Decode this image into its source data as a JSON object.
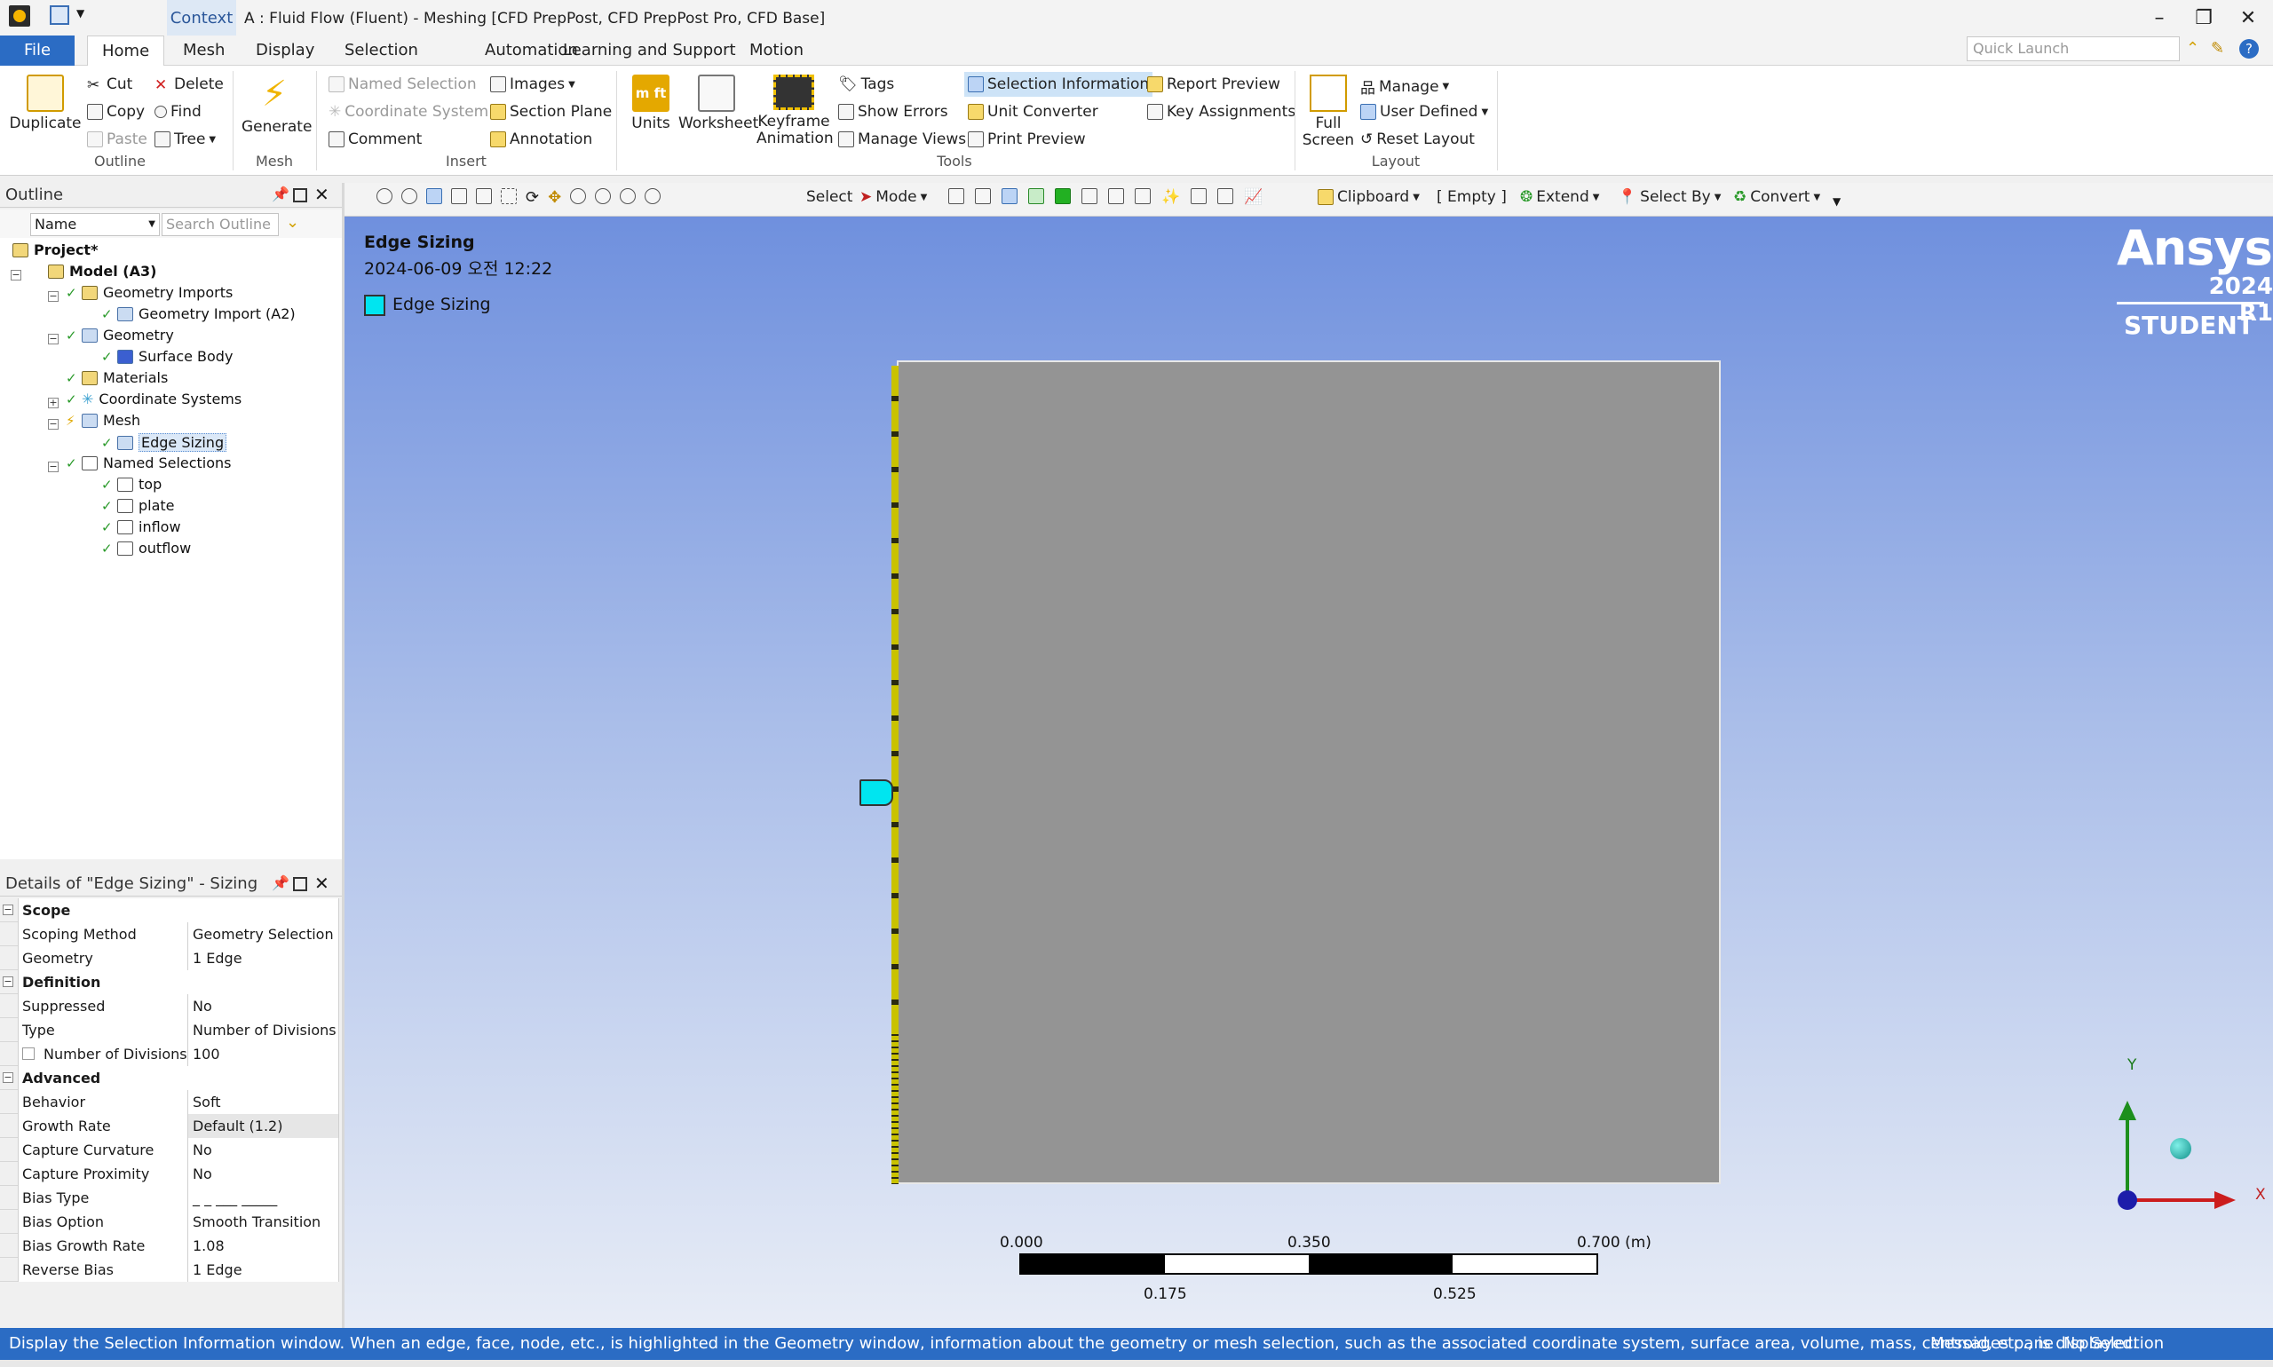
{
  "window": {
    "context_tab": "Context",
    "title": "A : Fluid Flow (Fluent) - Meshing [CFD PrepPost, CFD PrepPost Pro, CFD Base]",
    "controls": {
      "minimize": "–",
      "restore": "❐",
      "close": "✕"
    }
  },
  "menu": {
    "tabs": [
      "File",
      "Home",
      "Mesh",
      "Display",
      "Selection",
      "Automation",
      "Learning and Support",
      "Motion"
    ],
    "active": "Home",
    "quick_launch_placeholder": "Quick Launch"
  },
  "ribbon": {
    "outline": {
      "label": "Outline",
      "duplicate": "Duplicate",
      "cut": "Cut",
      "copy": "Copy",
      "paste": "Paste",
      "delete": "Delete",
      "find": "Find",
      "tree": "Tree"
    },
    "mesh": {
      "label": "Mesh",
      "generate": "Generate"
    },
    "insert": {
      "label": "Insert",
      "named_selection": "Named Selection",
      "coordinate_system": "Coordinate System",
      "comment": "Comment",
      "images": "Images",
      "section_plane": "Section Plane",
      "annotation": "Annotation"
    },
    "tools": {
      "label": "Tools",
      "units": "Units",
      "worksheet": "Worksheet",
      "keyframe": "Keyframe",
      "animation": "Animation",
      "tags": "Tags",
      "show_errors": "Show Errors",
      "manage_views": "Manage Views",
      "selection_information": "Selection Information",
      "unit_converter": "Unit Converter",
      "print_preview": "Print Preview",
      "report_preview": "Report Preview",
      "key_assignments": "Key Assignments"
    },
    "layout": {
      "label": "Layout",
      "full": "Full",
      "screen": "Screen",
      "manage": "Manage",
      "user_defined": "User Defined",
      "reset_layout": "Reset Layout"
    }
  },
  "outline_pane": {
    "title": "Outline",
    "filter": "Name",
    "search_placeholder": "Search Outline",
    "tree": [
      {
        "label": "Project*",
        "bold": true
      },
      {
        "label": "Model (A3)",
        "bold": true
      },
      {
        "label": "Geometry Imports"
      },
      {
        "label": "Geometry Import (A2)"
      },
      {
        "label": "Geometry"
      },
      {
        "label": "Surface Body"
      },
      {
        "label": "Materials"
      },
      {
        "label": "Coordinate Systems"
      },
      {
        "label": "Mesh"
      },
      {
        "label": "Edge Sizing"
      },
      {
        "label": "Named Selections"
      },
      {
        "label": "top"
      },
      {
        "label": "plate"
      },
      {
        "label": "inflow"
      },
      {
        "label": "outflow"
      }
    ]
  },
  "details_pane": {
    "title": "Details of \"Edge Sizing\" - Sizing",
    "rows": [
      {
        "section": "Scope"
      },
      {
        "k": "Scoping Method",
        "v": "Geometry Selection"
      },
      {
        "k": "Geometry",
        "v": "1 Edge"
      },
      {
        "section": "Definition"
      },
      {
        "k": "Suppressed",
        "v": "No"
      },
      {
        "k": "Type",
        "v": "Number of Divisions"
      },
      {
        "k": "Number of Divisions",
        "v": "100"
      },
      {
        "section": "Advanced"
      },
      {
        "k": "Behavior",
        "v": "Soft"
      },
      {
        "k": "Growth Rate",
        "v": "Default (1.2)"
      },
      {
        "k": "Capture Curvature",
        "v": "No"
      },
      {
        "k": "Capture Proximity",
        "v": "No"
      },
      {
        "k": "Bias Type",
        "v": "_ _ ___ _____"
      },
      {
        "k": "Bias Option",
        "v": "Smooth Transition"
      },
      {
        "k": "Bias Growth Rate",
        "v": "1.08"
      },
      {
        "k": "Reverse Bias",
        "v": "1 Edge"
      }
    ]
  },
  "view_toolbar": {
    "select": "Select",
    "mode": "Mode",
    "clipboard": "Clipboard",
    "empty": "[ Empty ]",
    "extend": "Extend",
    "select_by": "Select By",
    "convert": "Convert"
  },
  "viewport": {
    "heading": "Edge Sizing",
    "date": "2024-06-09 오전 12:22",
    "legend_label": "Edge Sizing",
    "legend_color": "#00e5f0",
    "brand": "Ansys",
    "version": "2024 R1",
    "edition": "STUDENT",
    "scale": {
      "t0": "0.000",
      "t1": "0.350",
      "t2": "0.700 (m)",
      "b1": "0.175",
      "b2": "0.525"
    },
    "axes": {
      "y": "Y",
      "x": "X"
    }
  },
  "status": {
    "message": "Display the Selection Information window. When an edge, face, node, etc., is highlighted in the Geometry window, information about the geometry or mesh selection, such as the associated coordinate system, surface area, volume, mass, centroid, etc., is displayed.",
    "messages_pane": "Messages pane",
    "selection": "No Selection"
  }
}
